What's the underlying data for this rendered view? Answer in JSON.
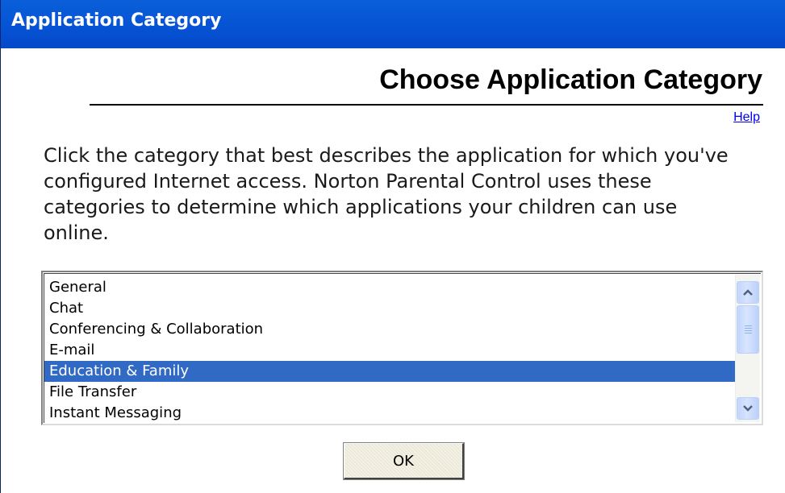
{
  "window": {
    "title": "Application Category"
  },
  "dialog": {
    "heading": "Choose Application Category",
    "help_link": "Help",
    "instructions": "Click the category that best describes the application for which you've configured Internet access. Norton Parental Control uses these categories to determine which applications your children can use online."
  },
  "category_list": {
    "items": [
      {
        "label": "General",
        "selected": false
      },
      {
        "label": "Chat",
        "selected": false
      },
      {
        "label": "Conferencing & Collaboration",
        "selected": false
      },
      {
        "label": "E-mail",
        "selected": false
      },
      {
        "label": "Education & Family",
        "selected": true
      },
      {
        "label": "File Transfer",
        "selected": false
      },
      {
        "label": "Instant Messaging",
        "selected": false
      }
    ],
    "selected_value": "Education & Family"
  },
  "buttons": {
    "ok_label": "OK"
  },
  "icons": {
    "scroll_up": "chevron-up-icon",
    "scroll_down": "chevron-down-icon"
  },
  "colors": {
    "titlebar": "#0654d6",
    "selection": "#316ac5",
    "link": "#0000ee"
  }
}
